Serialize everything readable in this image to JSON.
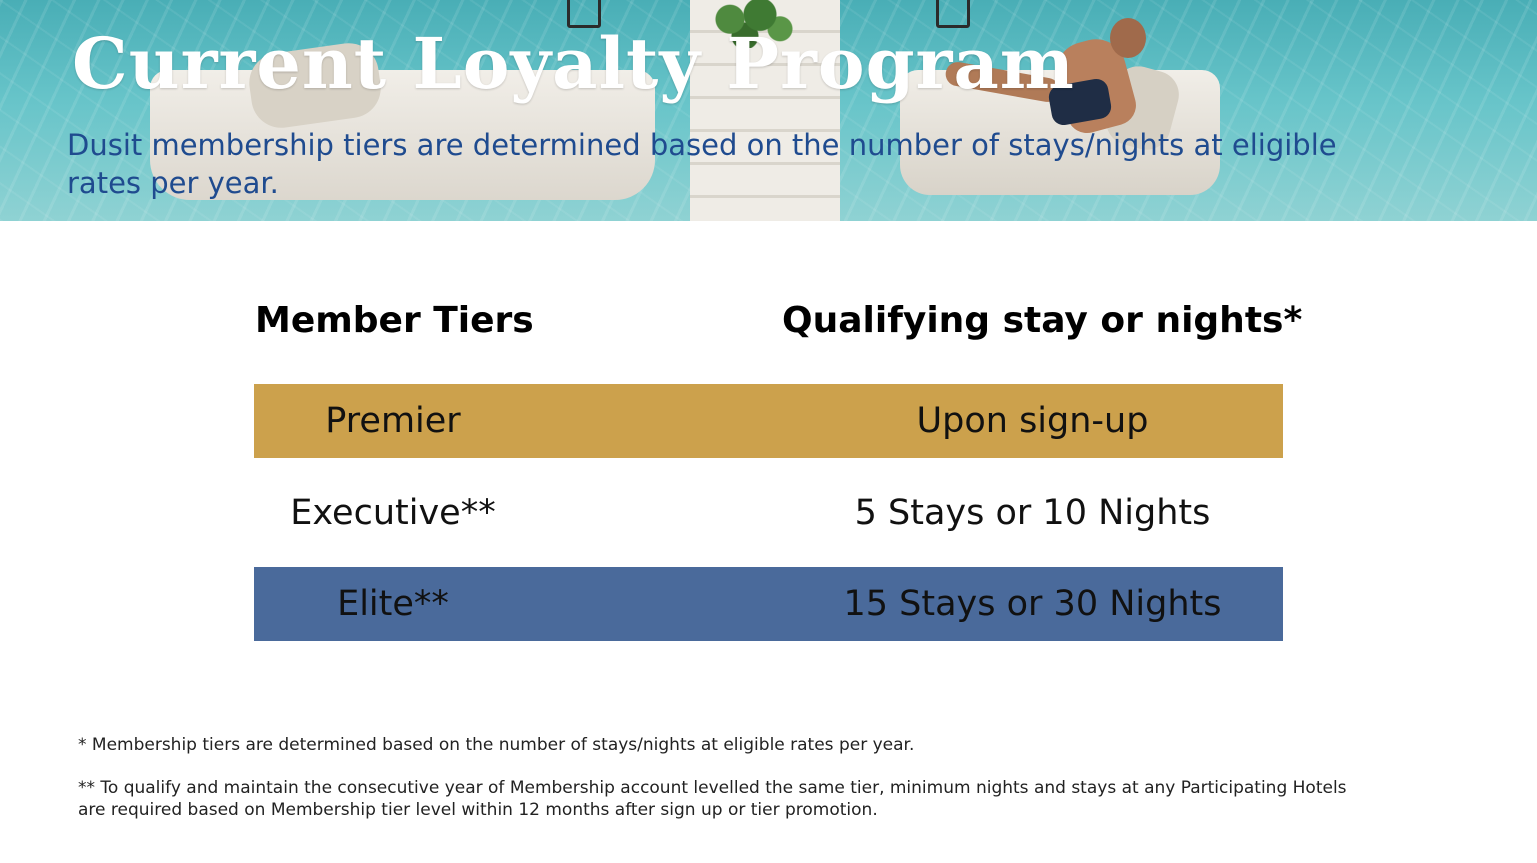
{
  "header": {
    "title": "Current Loyalty Program",
    "subtitle": "Dusit membership tiers are determined based on the number of stays/nights at eligible rates per year."
  },
  "table": {
    "columns": [
      "Member Tiers",
      "Qualifying stay or nights*"
    ],
    "rows": [
      {
        "tier": "Premier",
        "qualifying": "Upon sign-up",
        "color": "#cca14c"
      },
      {
        "tier": "Executive**",
        "qualifying": "5 Stays or 10 Nights",
        "color": "#ffffff"
      },
      {
        "tier": "Elite**",
        "qualifying": "15 Stays or 30 Nights",
        "color": "#4a6a9b"
      }
    ]
  },
  "footnotes": [
    "* Membership tiers are determined based on the number of stays/nights at eligible rates per year.",
    "** To qualify and maintain the consecutive year of Membership account levelled the same tier, minimum nights and stays at any Participating Hotels are required based on Membership tier level within 12 months after sign up or tier promotion."
  ],
  "colors": {
    "title": "#ffffff",
    "subtitle": "#1f4b8f",
    "premier": "#cca14c",
    "elite": "#4a6a9b"
  }
}
